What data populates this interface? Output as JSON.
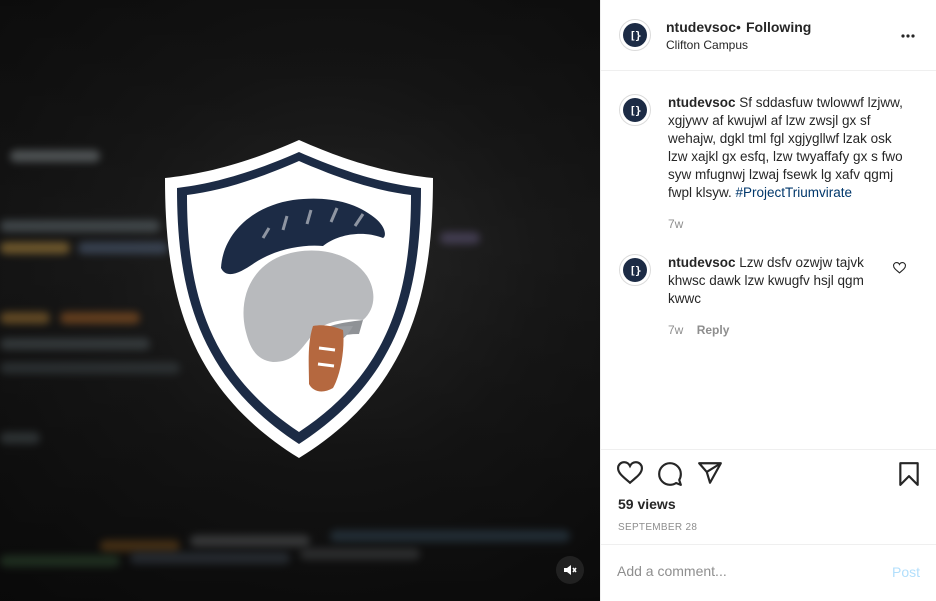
{
  "header": {
    "username": "ntudevsoc",
    "separator": "•",
    "follow_status": "Following",
    "location": "Clifton Campus",
    "more_icon": "more-horizontal-icon"
  },
  "avatar_glyph": "[}",
  "caption": {
    "username": "ntudevsoc",
    "text": "Sf sddasfuw twlowwf lzjww, xgjywv af kwujwl af lzw zwsjl gx sf wehajw, dgkl tml fgl xgjygllwf lzak osk lzw xajkl gx esfq, lzw twyaffafy gx s fwo syw mfugnwj lzwaj fsewk lg xafv qgmj fwpl klsyw.",
    "hashtag": "#ProjectTriumvirate",
    "age": "7w"
  },
  "comment": {
    "username": "ntudevsoc",
    "text": "Lzw dsfv ozwjw tajvk khwsc dawk lzw kwugfv hsjl qgm kwwc",
    "age": "7w",
    "reply_label": "Reply"
  },
  "actions": {
    "like_icon": "heart-icon",
    "comment_icon": "comment-bubble-icon",
    "share_icon": "paper-plane-icon",
    "save_icon": "bookmark-icon"
  },
  "stats": {
    "views": "59 views",
    "date": "SEPTEMBER 28"
  },
  "add_comment": {
    "placeholder": "Add a comment...",
    "post_label": "Post"
  },
  "colors": {
    "shield_navy": "#1c2b45",
    "helmet_grey": "#b8babd",
    "leather_brown": "#b5683f",
    "link_blue": "#00376b",
    "post_disabled": "#b2dffc"
  }
}
